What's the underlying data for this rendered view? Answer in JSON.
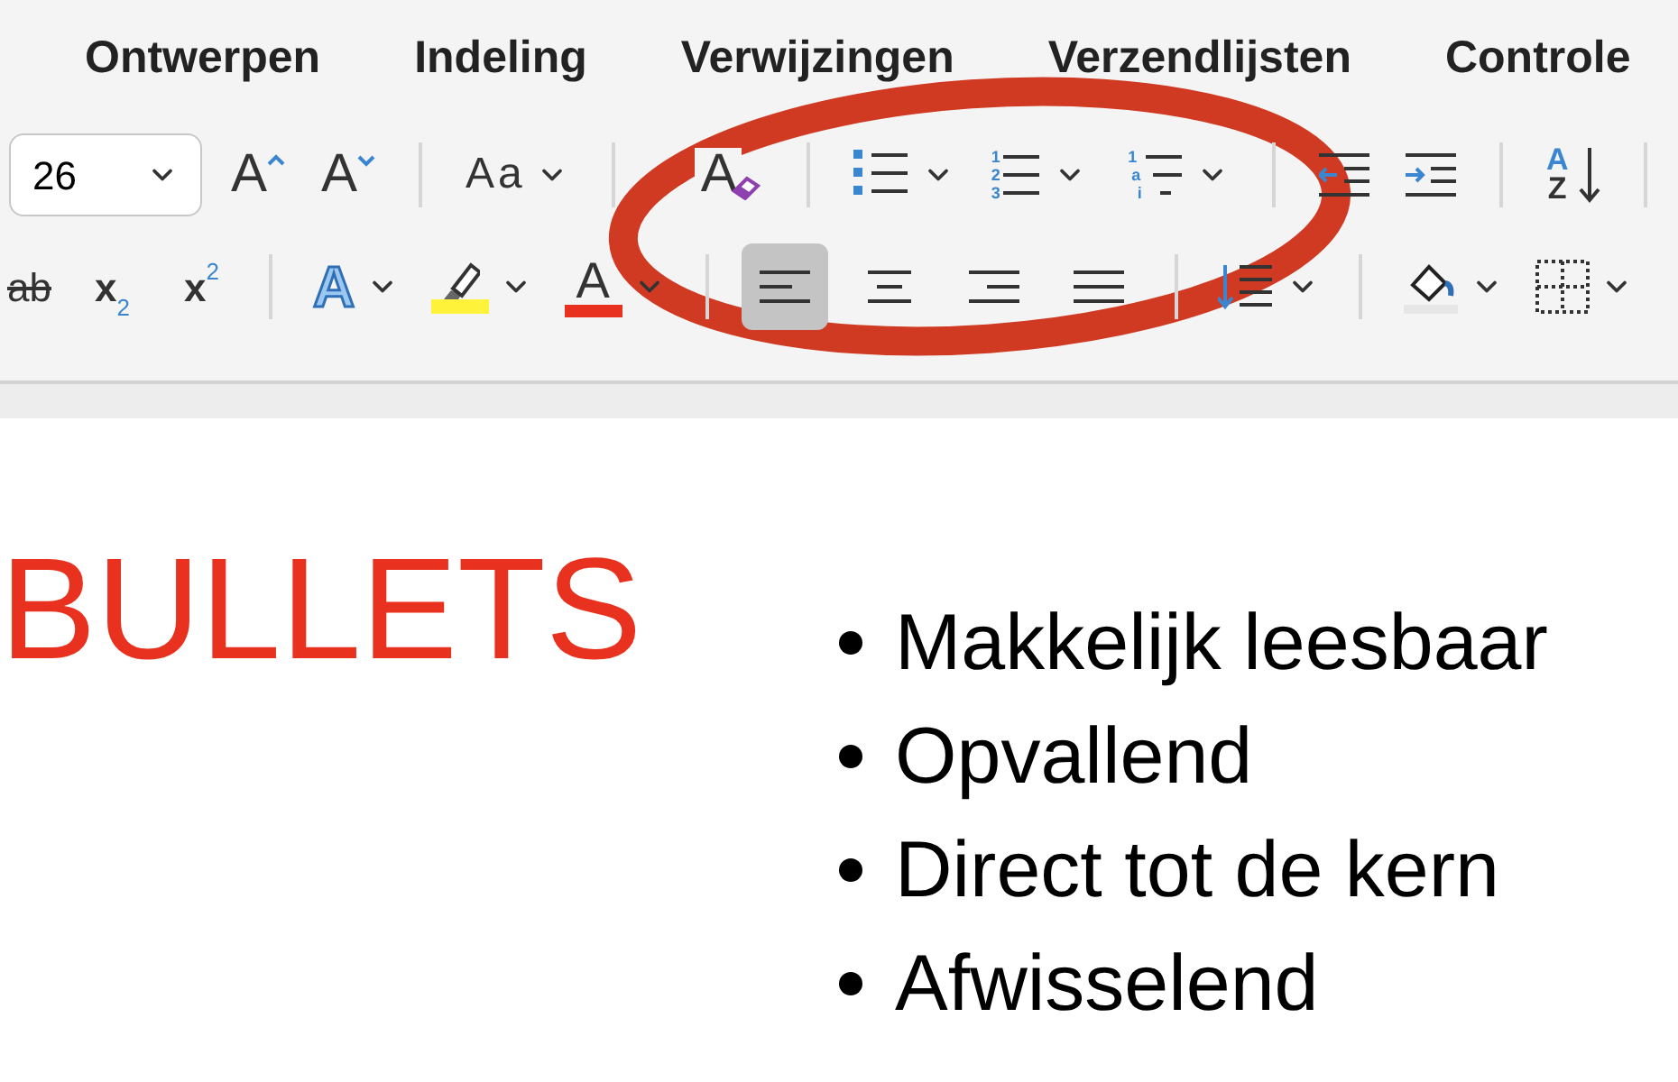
{
  "tabs": [
    {
      "label": "Ontwerpen",
      "selected": false
    },
    {
      "label": "Indeling",
      "selected": false
    },
    {
      "label": "Verwijzingen",
      "selected": false
    },
    {
      "label": "Verzendlijsten",
      "selected": false
    },
    {
      "label": "Controle",
      "selected": false
    }
  ],
  "toolbar": {
    "top_row": [
      {
        "kind": "select",
        "value": "26"
      },
      {
        "kind": "grow",
        "glyph": "A"
      },
      {
        "kind": "shrink",
        "glyph": "A"
      },
      {
        "kind": "sep"
      },
      {
        "kind": "case",
        "glyph": "Aa",
        "dropdown": true
      },
      {
        "kind": "sep"
      },
      {
        "kind": "clear",
        "glyph": "A"
      },
      {
        "kind": "sep"
      },
      {
        "kind": "bullets",
        "dropdown": true
      },
      {
        "kind": "numbering",
        "glyphs": [
          "1",
          "2",
          "3"
        ],
        "dropdown": true
      },
      {
        "kind": "multilevel",
        "glyphs": [
          "1",
          "a",
          "i"
        ],
        "dropdown": true
      },
      {
        "kind": "sep"
      },
      {
        "kind": "outdent"
      },
      {
        "kind": "indent"
      },
      {
        "kind": "sep"
      },
      {
        "kind": "sort",
        "glyphs": [
          "A",
          "Z"
        ]
      },
      {
        "kind": "sep"
      }
    ],
    "bottom_row": [
      {
        "kind": "strike",
        "glyph": "ab"
      },
      {
        "kind": "sub",
        "glyph": "x",
        "small": "2"
      },
      {
        "kind": "sup",
        "glyph": "x",
        "small": "2"
      },
      {
        "kind": "sep"
      },
      {
        "kind": "effects",
        "glyph": "A",
        "dropdown": true
      },
      {
        "kind": "highlight",
        "color": "#fff23a",
        "dropdown": true
      },
      {
        "kind": "fontcolor",
        "glyph": "A",
        "color": "#e8321f",
        "dropdown": true
      },
      {
        "kind": "sep"
      },
      {
        "kind": "align_left",
        "selected": true
      },
      {
        "kind": "align_center",
        "selected": false
      },
      {
        "kind": "align_right",
        "selected": false
      },
      {
        "kind": "align_justify",
        "selected": false
      },
      {
        "kind": "sep"
      },
      {
        "kind": "spacing",
        "dropdown": true
      },
      {
        "kind": "sep"
      },
      {
        "kind": "shading",
        "dropdown": true
      },
      {
        "kind": "borders",
        "dropdown": true
      }
    ]
  },
  "document": {
    "title": "BULLETS",
    "bullets": [
      "Makkelijk leesbaar",
      "Opvallend",
      "Direct tot de kern",
      "Afwisselend"
    ]
  },
  "annotation": {
    "kind": "ellipse",
    "color": "#d03a22"
  }
}
